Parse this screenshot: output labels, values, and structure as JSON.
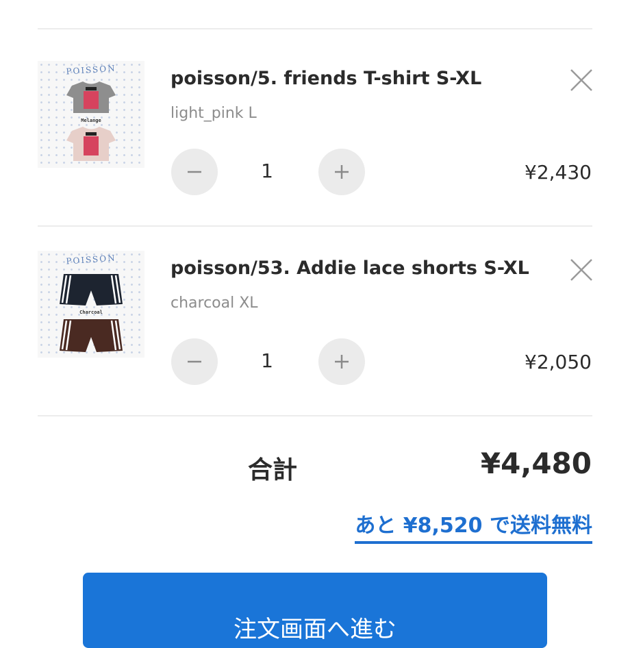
{
  "cart": {
    "items": [
      {
        "title": "poisson/5. friends T-shirt S-XL",
        "variant": "light_pink L",
        "quantity": "1",
        "price": "¥2,430",
        "thumbnail": {
          "brand": "POISSON",
          "color_tag": "Melange",
          "product": "tshirt"
        }
      },
      {
        "title": "poisson/53. Addie lace shorts S-XL",
        "variant": "charcoal XL",
        "quantity": "1",
        "price": "¥2,050",
        "thumbnail": {
          "brand": "POISSON",
          "color_tag": "Charcoal",
          "product": "shorts"
        }
      }
    ],
    "icons": {
      "decrease": "minus-icon",
      "increase": "plus-icon",
      "remove": "close-icon"
    }
  },
  "summary": {
    "total_label": "合計",
    "total_value": "¥4,480",
    "free_shipping_message": "あと ¥8,520 で送料無料"
  },
  "checkout": {
    "button_label": "注文画面へ進む"
  },
  "colors": {
    "accent": "#1a75d8",
    "link": "#1e6fd0",
    "text": "#2b2b2b",
    "muted": "#8c8c8c",
    "stepper_bg": "#ebebeb",
    "divider": "#ececec"
  }
}
